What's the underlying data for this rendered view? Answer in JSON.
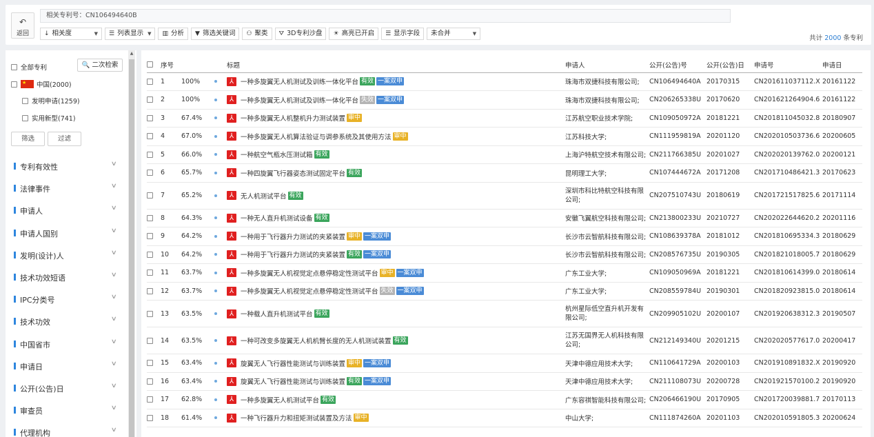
{
  "toolbar": {
    "back_label": "返回",
    "related_patent": "相关专利号：CN106494640B",
    "sort_label": "相关度",
    "list_display_label": "列表显示",
    "analysis_label": "分析",
    "filter_keywords_label": "筛选关键词",
    "cluster_label": "聚类",
    "sandbox_label": "3D专利沙盘",
    "highlight_label": "高亮已开启",
    "display_fields_label": "显示字段",
    "merge_label": "未合并",
    "total_prefix": "共计",
    "total_count": "2000",
    "total_suffix": "条专利"
  },
  "sidebar": {
    "all_patents": "全部专利",
    "secondary_search": "二次检索",
    "china": "中国(2000)",
    "invention": "发明申请(1259)",
    "utility": "实用新型(741)",
    "filter_btn": "筛选",
    "exclude_btn": "过滤",
    "facets": [
      "专利有效性",
      "法律事件",
      "申请人",
      "申请人国别",
      "发明(设计)人",
      "技术功效短语",
      "IPC分类号",
      "技术功效",
      "中国省市",
      "申请日",
      "公开(公告)日",
      "审查员",
      "代理机构"
    ]
  },
  "table": {
    "headers": {
      "seq": "序号",
      "title": "标题",
      "applicant": "申请人",
      "pub_no": "公开(公告)号",
      "pub_date": "公开(公告)日",
      "app_no": "申请号",
      "app_date": "申请日"
    },
    "rows": [
      {
        "seq": "1",
        "pct": "100%",
        "title": "一种多旋翼无人机测试及训练一体化平台",
        "tags": [
          "有效",
          "一案双申"
        ],
        "applicant": "珠海市双捷科技有限公司;",
        "pub_no": "CN106494640A",
        "pub_date": "20170315",
        "app_no": "CN201611037112.X",
        "app_date": "20161122"
      },
      {
        "seq": "2",
        "pct": "100%",
        "title": "一种多旋翼无人机测试及训练一体化平台",
        "tags": [
          "失效",
          "一案双申"
        ],
        "applicant": "珠海市双捷科技有限公司;",
        "pub_no": "CN206265338U",
        "pub_date": "20170620",
        "app_no": "CN201621264904.6",
        "app_date": "20161122"
      },
      {
        "seq": "3",
        "pct": "67.4%",
        "title": "一种多旋翼无人机整机升力测试装置",
        "tags": [
          "审中"
        ],
        "applicant": "江苏航空职业技术学院;",
        "pub_no": "CN109050972A",
        "pub_date": "20181221",
        "app_no": "CN201811045032.8",
        "app_date": "20180907"
      },
      {
        "seq": "4",
        "pct": "67.0%",
        "title": "一种多旋翼无人机算法验证与调参系统及其使用方法",
        "tags": [
          "审中"
        ],
        "applicant": "江苏科技大学;",
        "pub_no": "CN111959819A",
        "pub_date": "20201120",
        "app_no": "CN202010503736.6",
        "app_date": "20200605"
      },
      {
        "seq": "5",
        "pct": "66.0%",
        "title": "一种航空气瓶水压测试箱",
        "tags": [
          "有效"
        ],
        "applicant": "上海沪特航空技术有限公司;",
        "pub_no": "CN211766385U",
        "pub_date": "20201027",
        "app_no": "CN202020139762.0",
        "app_date": "20200121"
      },
      {
        "seq": "6",
        "pct": "65.7%",
        "title": "一种四旋翼飞行器姿态测试固定平台",
        "tags": [
          "有效"
        ],
        "applicant": "昆明理工大学;",
        "pub_no": "CN107444672A",
        "pub_date": "20171208",
        "app_no": "CN201710486421.3",
        "app_date": "20170623"
      },
      {
        "seq": "7",
        "pct": "65.2%",
        "title": "无人机测试平台",
        "tags": [
          "有效"
        ],
        "applicant": "深圳市科比特航空科技有限公司;",
        "pub_no": "CN207510743U",
        "pub_date": "20180619",
        "app_no": "CN201721517825.6",
        "app_date": "20171114"
      },
      {
        "seq": "8",
        "pct": "64.3%",
        "title": "一种无人直升机测试设备",
        "tags": [
          "有效"
        ],
        "applicant": "安徽飞翼航空科技有限公司;",
        "pub_no": "CN213800233U",
        "pub_date": "20210727",
        "app_no": "CN202022644620.2",
        "app_date": "20201116"
      },
      {
        "seq": "9",
        "pct": "64.2%",
        "title": "一种用于飞行器升力测试的夹紧装置",
        "tags": [
          "审中",
          "一案双申"
        ],
        "applicant": "长沙市云智航科技有限公司;",
        "pub_no": "CN108639378A",
        "pub_date": "20181012",
        "app_no": "CN201810695334.3",
        "app_date": "20180629"
      },
      {
        "seq": "10",
        "pct": "64.2%",
        "title": "一种用于飞行器升力测试的夹紧装置",
        "tags": [
          "有效",
          "一案双申"
        ],
        "applicant": "长沙市云智航科技有限公司;",
        "pub_no": "CN208576735U",
        "pub_date": "20190305",
        "app_no": "CN201821018005.7",
        "app_date": "20180629"
      },
      {
        "seq": "11",
        "pct": "63.7%",
        "title": "一种多旋翼无人机视觉定点悬停稳定性测试平台",
        "tags": [
          "审中",
          "一案双申"
        ],
        "applicant": "广东工业大学;",
        "pub_no": "CN109050969A",
        "pub_date": "20181221",
        "app_no": "CN201810614399.0",
        "app_date": "20180614"
      },
      {
        "seq": "12",
        "pct": "63.7%",
        "title": "一种多旋翼无人机视觉定点悬停稳定性测试平台",
        "tags": [
          "失效",
          "一案双申"
        ],
        "applicant": "广东工业大学;",
        "pub_no": "CN208559784U",
        "pub_date": "20190301",
        "app_no": "CN201820923815.0",
        "app_date": "20180614"
      },
      {
        "seq": "13",
        "pct": "63.5%",
        "title": "一种载人直升机测试平台",
        "tags": [
          "有效"
        ],
        "applicant": "杭州星际低空直升机开发有限公司;",
        "pub_no": "CN209905102U",
        "pub_date": "20200107",
        "app_no": "CN201920638312.3",
        "app_date": "20190507"
      },
      {
        "seq": "14",
        "pct": "63.5%",
        "title": "一种可改变多旋翼无人机机臂长度的无人机测试装置",
        "tags": [
          "有效"
        ],
        "applicant": "江苏无国界无人机科技有限公司;",
        "pub_no": "CN212149340U",
        "pub_date": "20201215",
        "app_no": "CN202020577617.0",
        "app_date": "20200417"
      },
      {
        "seq": "15",
        "pct": "63.4%",
        "title": "旋翼无人飞行器性能测试与训练装置",
        "tags": [
          "审中",
          "一案双申"
        ],
        "applicant": "天津中德应用技术大学;",
        "pub_no": "CN110641729A",
        "pub_date": "20200103",
        "app_no": "CN201910891832.X",
        "app_date": "20190920"
      },
      {
        "seq": "16",
        "pct": "63.4%",
        "title": "旋翼无人飞行器性能测试与训练装置",
        "tags": [
          "有效",
          "一案双申"
        ],
        "applicant": "天津中德应用技术大学;",
        "pub_no": "CN211108073U",
        "pub_date": "20200728",
        "app_no": "CN201921570100.2",
        "app_date": "20190920"
      },
      {
        "seq": "17",
        "pct": "62.8%",
        "title": "一种多旋翼无人机测试平台",
        "tags": [
          "有效"
        ],
        "applicant": "广东容祺智能科技有限公司;",
        "pub_no": "CN206466190U",
        "pub_date": "20170905",
        "app_no": "CN201720039881.7",
        "app_date": "20170113"
      },
      {
        "seq": "18",
        "pct": "61.4%",
        "title": "一种飞行器升力和扭矩测试装置及方法",
        "tags": [
          "审中"
        ],
        "applicant": "中山大学;",
        "pub_no": "CN111874260A",
        "pub_date": "20201103",
        "app_no": "CN202010591805.3",
        "app_date": "20200624"
      }
    ]
  }
}
